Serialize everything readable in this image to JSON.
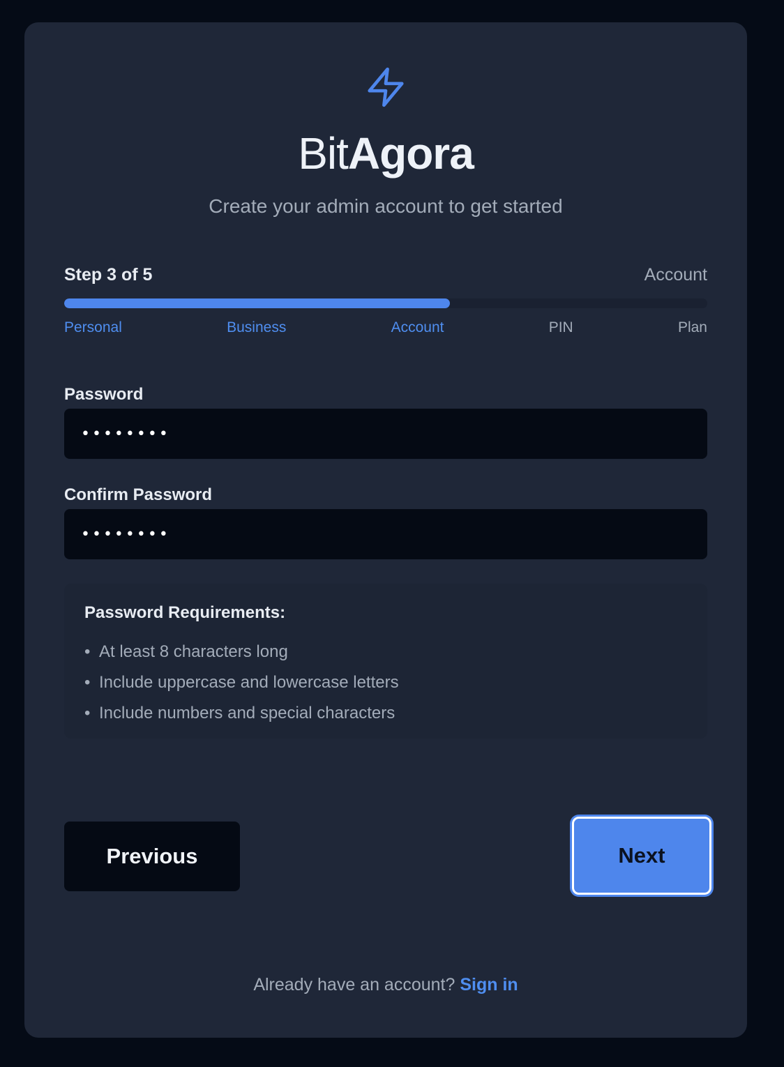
{
  "brand": {
    "name_light": "Bit",
    "name_bold": "Agora",
    "icon": "lightning-bolt-icon",
    "accent_color": "#4e86ec"
  },
  "subtitle": "Create your admin account to get started",
  "progress": {
    "step_text": "Step 3 of 5",
    "current_step_name": "Account",
    "fraction_complete": 0.6,
    "steps": [
      {
        "label": "Personal",
        "done": true
      },
      {
        "label": "Business",
        "done": true
      },
      {
        "label": "Account",
        "done": true
      },
      {
        "label": "PIN",
        "done": false
      },
      {
        "label": "Plan",
        "done": false
      }
    ]
  },
  "form": {
    "password_label": "Password",
    "password_value": "••••••••",
    "confirm_label": "Confirm Password",
    "confirm_value": "••••••••"
  },
  "requirements": {
    "title": "Password Requirements:",
    "bullet": "•",
    "items": [
      "At least 8 characters long",
      "Include uppercase and lowercase letters",
      "Include numbers and special characters"
    ]
  },
  "actions": {
    "previous_label": "Previous",
    "next_label": "Next"
  },
  "footer": {
    "prompt": "Already have an account?",
    "link_label": "Sign in"
  }
}
